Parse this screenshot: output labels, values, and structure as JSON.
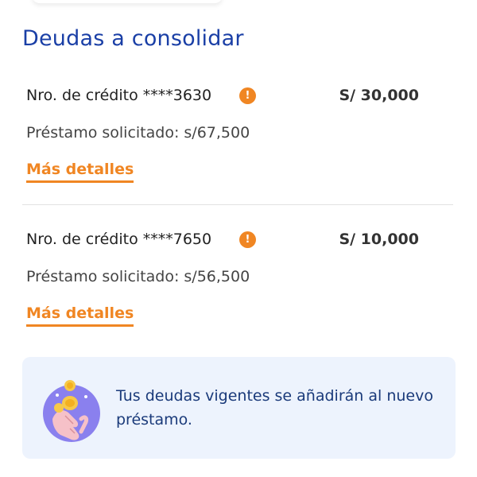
{
  "section": {
    "title": "Deudas a consolidar"
  },
  "debts": [
    {
      "credit_label": "Nro. de crédito ****3630",
      "info_icon": "info-icon",
      "amount": "S/ 30,000",
      "requested": "Préstamo solicitado: s/67,500",
      "details_link": "Más detalles"
    },
    {
      "credit_label": "Nro. de crédito ****7650",
      "info_icon": "info-icon",
      "amount": "S/ 10,000",
      "requested": "Préstamo solicitado: s/56,500",
      "details_link": "Más detalles"
    }
  ],
  "note": {
    "icon": "hand-coins-icon",
    "text": "Tus deudas vigentes se añadirán al nuevo préstamo."
  },
  "colors": {
    "title": "#1a3fa6",
    "accent": "#f08623",
    "note_background": "#edf3fd",
    "note_text": "#1a3a7a"
  }
}
